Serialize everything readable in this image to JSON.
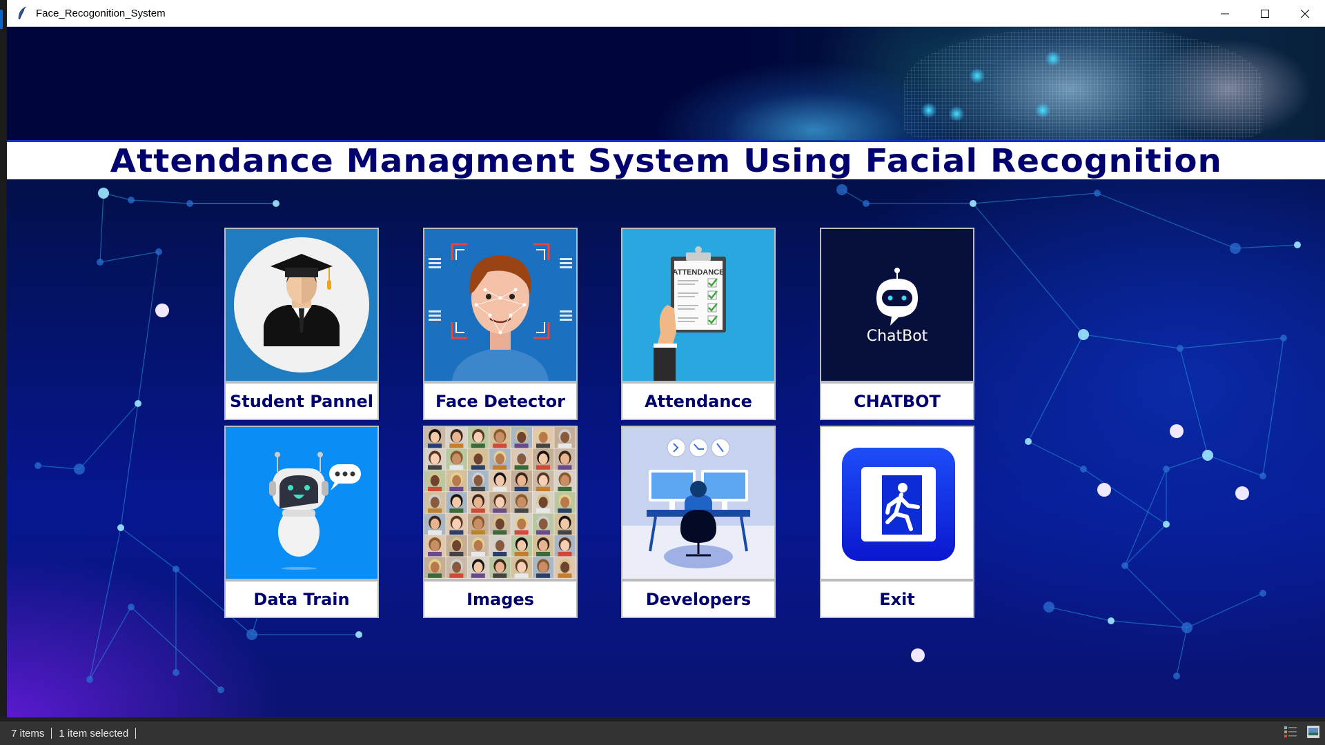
{
  "window": {
    "title": "Face_Recogonition_System",
    "app_icon": "feather-icon",
    "controls": [
      "minimize",
      "maximize",
      "close"
    ]
  },
  "header": {
    "title": "Attendance Managment System Using Facial Recognition",
    "banner_image": "facial-recognition-face-scan"
  },
  "colors": {
    "title_text": "#00006e",
    "background": "#061690",
    "label_bg": "#ffffff"
  },
  "cards": [
    {
      "label": "Student Pannel",
      "image": "graduate-student"
    },
    {
      "label": "Face Detector",
      "image": "face-scan"
    },
    {
      "label": "Attendance",
      "image": "attendance-clipboard",
      "image_text": "ATTENDANCE"
    },
    {
      "label": "CHATBOT",
      "image": "chatbot-logo",
      "image_text": "ChatBot"
    },
    {
      "label": "Data Train",
      "image": "robot-assistant"
    },
    {
      "label": "Images",
      "image": "face-grid"
    },
    {
      "label": "Developers",
      "image": "developer-desk"
    },
    {
      "label": "Exit",
      "image": "exit-sign"
    }
  ],
  "statusbar": {
    "items_count": "7 items",
    "selection": "1 item selected"
  }
}
